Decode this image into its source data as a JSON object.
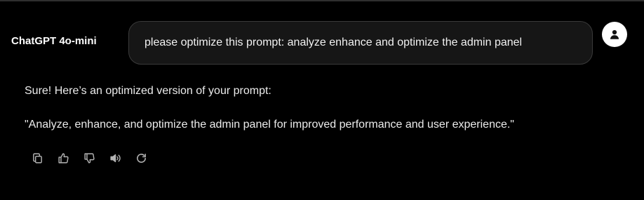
{
  "header": {
    "model_label": "ChatGPT 4o-mini"
  },
  "user_message": {
    "text": "please optimize this prompt: analyze enhance and optimize the admin panel"
  },
  "assistant_message": {
    "intro": "Sure! Here’s an optimized version of your prompt:",
    "quote": "\"Analyze, enhance, and optimize the admin panel for improved performance and user experience.\""
  },
  "actions": [
    "copy-icon",
    "thumbs-up-icon",
    "thumbs-down-icon",
    "speaker-icon",
    "regenerate-icon"
  ],
  "colors": {
    "background": "#000000",
    "text": "#ececec",
    "bubble": "#161616",
    "bubble_border": "#3a3a3a",
    "icon": "#b4b4b4"
  }
}
